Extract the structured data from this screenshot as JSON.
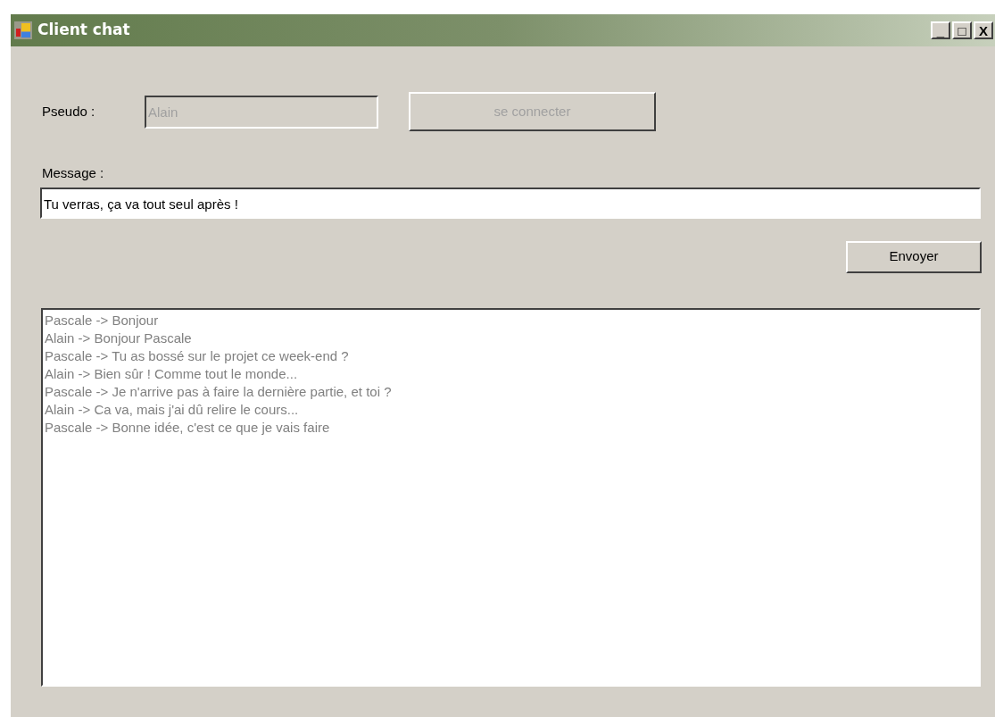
{
  "window": {
    "title": "Client chat",
    "controls": [
      "_",
      "□",
      "X"
    ]
  },
  "pseudo": {
    "label": "Pseudo :",
    "value": "Alain",
    "disabled": true
  },
  "connect_button": {
    "label": "se connecter",
    "disabled": true
  },
  "message": {
    "label": "Message :",
    "value": "Tu verras, ça va tout seul après !"
  },
  "send_button": {
    "label": "Envoyer",
    "disabled": false
  },
  "chat_log": {
    "disabled": true,
    "lines": [
      "Pascale -> Bonjour",
      "Alain -> Bonjour Pascale",
      "Pascale -> Tu as bossé sur le projet ce week-end ?",
      "Alain -> Bien sûr ! Comme tout le monde...",
      "Pascale -> Je n'arrive pas à faire la dernière partie, et toi ?",
      "Alain -> Ca va, mais j'ai dû relire le cours...",
      "Pascale -> Bonne idée, c'est ce que je vais faire"
    ]
  }
}
